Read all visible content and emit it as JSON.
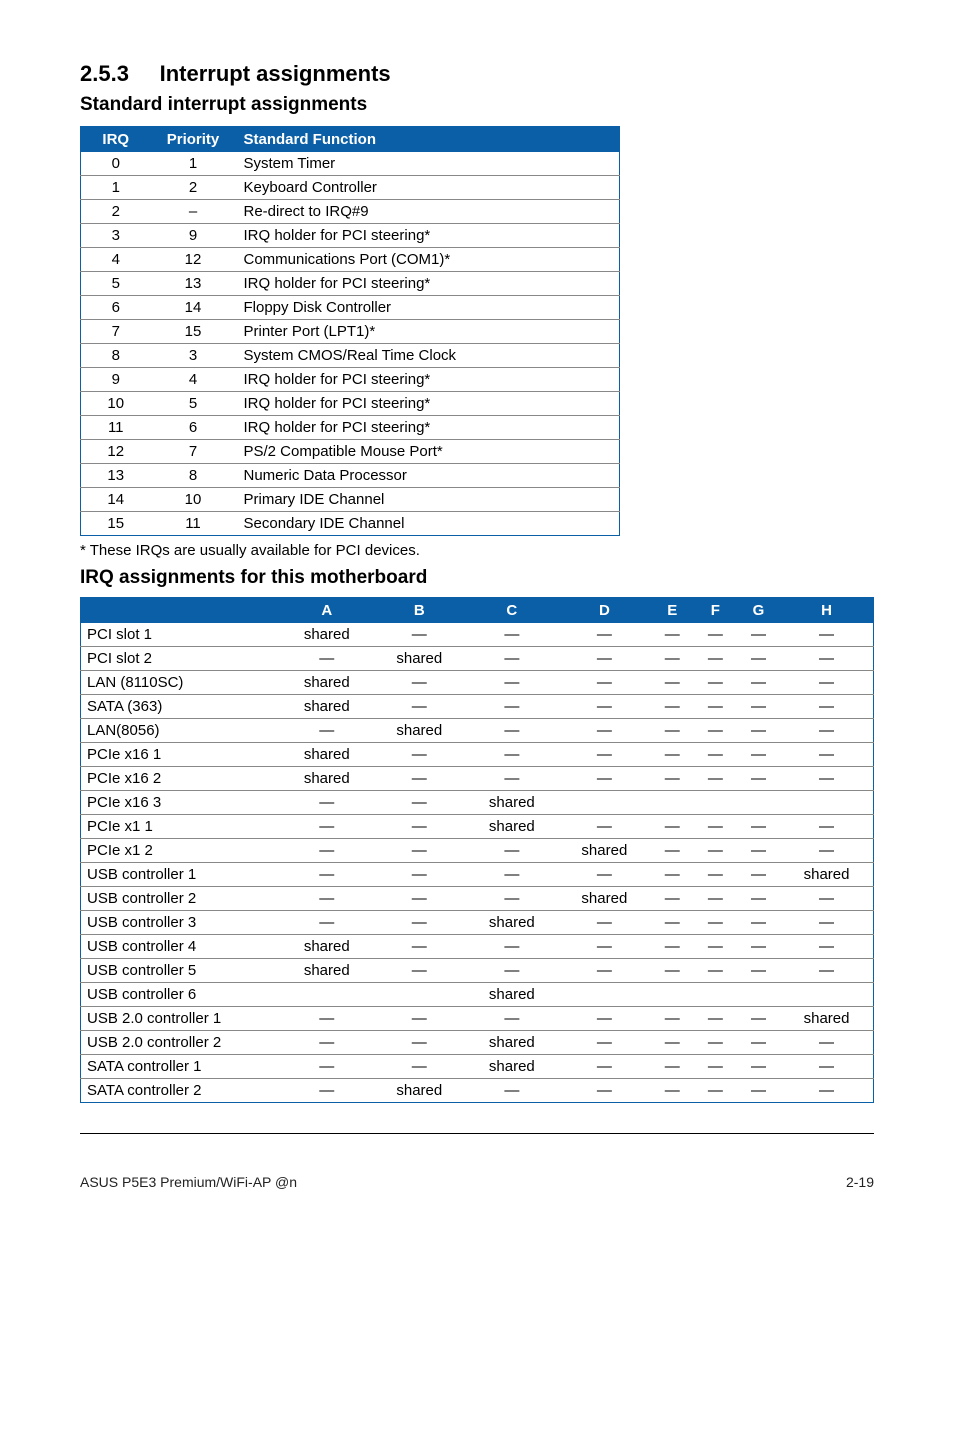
{
  "section": {
    "number": "2.5.3",
    "title": "Interrupt assignments"
  },
  "sub1": "Standard interrupt assignments",
  "t1_headers": {
    "irq": "IRQ",
    "priority": "Priority",
    "func": "Standard Function"
  },
  "t1_rows": [
    {
      "irq": "0",
      "pri": "1",
      "func": "System Timer"
    },
    {
      "irq": "1",
      "pri": "2",
      "func": "Keyboard Controller"
    },
    {
      "irq": "2",
      "pri": "–",
      "func": "Re-direct to IRQ#9"
    },
    {
      "irq": "3",
      "pri": "9",
      "func": "IRQ holder for PCI steering*"
    },
    {
      "irq": "4",
      "pri": "12",
      "func": "Communications Port (COM1)*"
    },
    {
      "irq": "5",
      "pri": "13",
      "func": "IRQ holder for PCI steering*"
    },
    {
      "irq": "6",
      "pri": "14",
      "func": "Floppy Disk Controller"
    },
    {
      "irq": "7",
      "pri": "15",
      "func": "Printer Port (LPT1)*"
    },
    {
      "irq": "8",
      "pri": "3",
      "func": "System CMOS/Real Time Clock"
    },
    {
      "irq": "9",
      "pri": "4",
      "func": "IRQ holder for PCI steering*"
    },
    {
      "irq": "10",
      "pri": "5",
      "func": "IRQ holder for PCI steering*"
    },
    {
      "irq": "11",
      "pri": "6",
      "func": "IRQ holder for PCI steering*"
    },
    {
      "irq": "12",
      "pri": "7",
      "func": "PS/2 Compatible Mouse Port*"
    },
    {
      "irq": "13",
      "pri": "8",
      "func": "Numeric Data Processor"
    },
    {
      "irq": "14",
      "pri": "10",
      "func": "Primary IDE Channel"
    },
    {
      "irq": "15",
      "pri": "11",
      "func": "Secondary IDE Channel"
    }
  ],
  "footnote": "* These IRQs are usually available for PCI devices.",
  "sub2": "IRQ assignments for this motherboard",
  "t2_headers": [
    "",
    "A",
    "B",
    "C",
    "D",
    "E",
    "F",
    "G",
    "H"
  ],
  "t2_rows": [
    {
      "name": "PCI slot 1",
      "cells": [
        "shared",
        "—",
        "—",
        "—",
        "—",
        "—",
        "—",
        "—"
      ]
    },
    {
      "name": "PCI slot 2",
      "cells": [
        "—",
        "shared",
        "—",
        "—",
        "—",
        "—",
        "—",
        "—"
      ]
    },
    {
      "name": "LAN (8110SC)",
      "cells": [
        "shared",
        "—",
        "—",
        "—",
        "—",
        "—",
        "—",
        "—"
      ]
    },
    {
      "name": "SATA (363)",
      "cells": [
        "shared",
        "—",
        "—",
        "—",
        "—",
        "—",
        "—",
        "—"
      ]
    },
    {
      "name": "LAN(8056)",
      "cells": [
        "—",
        "shared",
        "—",
        "—",
        "—",
        "—",
        "—",
        "—"
      ]
    },
    {
      "name": "PCIe x16 1",
      "cells": [
        "shared",
        "—",
        "—",
        "—",
        "—",
        "—",
        "—",
        "—"
      ]
    },
    {
      "name": "PCIe x16 2",
      "cells": [
        "shared",
        "—",
        "—",
        "—",
        "—",
        "—",
        "—",
        "—"
      ]
    },
    {
      "name": "PCIe x16 3",
      "cells": [
        "—",
        "—",
        "shared",
        "",
        "",
        "",
        "",
        ""
      ]
    },
    {
      "name": "PCIe x1 1",
      "cells": [
        "—",
        "—",
        "shared",
        "—",
        "—",
        "—",
        "—",
        "—"
      ]
    },
    {
      "name": "PCIe x1 2",
      "cells": [
        "—",
        "—",
        "—",
        "shared",
        "—",
        "—",
        "—",
        "—"
      ]
    },
    {
      "name": "USB controller 1",
      "cells": [
        "—",
        "—",
        "—",
        "—",
        "—",
        "—",
        "—",
        "shared"
      ]
    },
    {
      "name": "USB controller 2",
      "cells": [
        "—",
        "—",
        "—",
        "shared",
        "—",
        "—",
        "—",
        "—"
      ]
    },
    {
      "name": "USB controller 3",
      "cells": [
        "—",
        "—",
        "shared",
        "—",
        "—",
        "—",
        "—",
        "—"
      ]
    },
    {
      "name": "USB controller 4",
      "cells": [
        "shared",
        "—",
        "—",
        "—",
        "—",
        "—",
        "—",
        "—"
      ]
    },
    {
      "name": "USB controller 5",
      "cells": [
        "shared",
        "—",
        "—",
        "—",
        "—",
        "—",
        "—",
        "—"
      ]
    },
    {
      "name": "USB controller 6",
      "cells": [
        "",
        "",
        "shared",
        "",
        "",
        "",
        "",
        ""
      ]
    },
    {
      "name": "USB 2.0 controller 1",
      "cells": [
        "—",
        "—",
        "—",
        "—",
        "—",
        "—",
        "—",
        "shared"
      ]
    },
    {
      "name": "USB 2.0 controller 2",
      "cells": [
        "—",
        "—",
        "shared",
        "—",
        "—",
        "—",
        "—",
        "—"
      ]
    },
    {
      "name": "SATA controller 1",
      "cells": [
        "—",
        "—",
        "shared",
        "—",
        "—",
        "—",
        "—",
        "—"
      ]
    },
    {
      "name": "SATA controller 2",
      "cells": [
        "—",
        "shared",
        "—",
        "—",
        "—",
        "—",
        "—",
        "—"
      ]
    }
  ],
  "footer": {
    "left": "ASUS P5E3 Premium/WiFi-AP @n",
    "right": "2-19"
  }
}
